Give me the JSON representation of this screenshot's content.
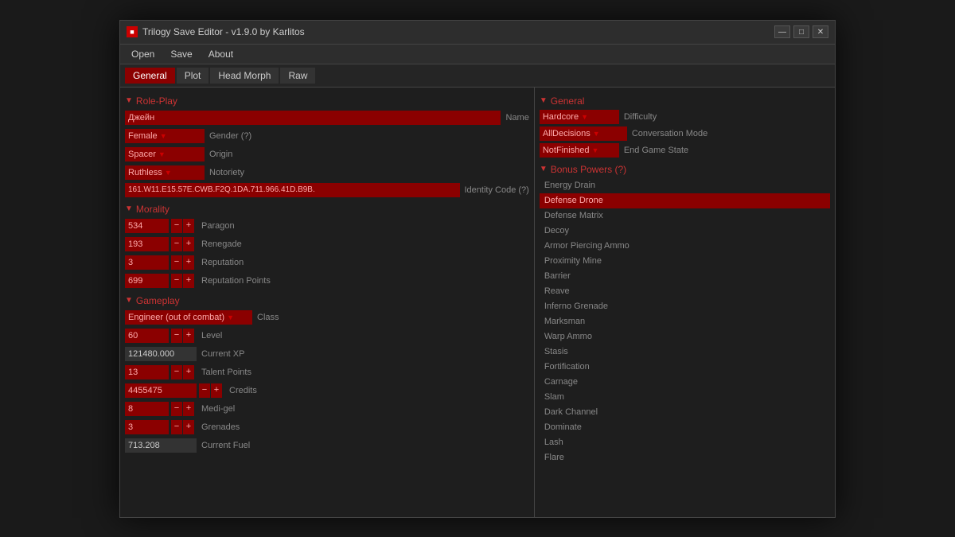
{
  "window": {
    "icon": "■",
    "title": "Trilogy Save Editor - v1.9.0 by Karlitos",
    "controls": {
      "minimize": "—",
      "maximize": "□",
      "close": "✕"
    }
  },
  "menu": {
    "items": [
      "Open",
      "Save",
      "About"
    ]
  },
  "tabs": [
    {
      "label": "General",
      "active": true
    },
    {
      "label": "Plot",
      "active": false
    },
    {
      "label": "Head Morph",
      "active": false
    },
    {
      "label": "Raw",
      "active": false
    }
  ],
  "left": {
    "roleplay": {
      "header": "Role-Play",
      "name_value": "Джейн",
      "name_label": "Name",
      "gender_value": "Female",
      "gender_label": "Gender (?)",
      "origin_value": "Spacer",
      "origin_label": "Origin",
      "notoriety_value": "Ruthless",
      "notoriety_label": "Notoriety",
      "identity_value": "161.W11.E15.57E.CWB.F2Q.1DA.711.966.41D.B9B.",
      "identity_label": "Identity Code (?)"
    },
    "morality": {
      "header": "Morality",
      "paragon_value": "534",
      "paragon_label": "Paragon",
      "renegade_value": "193",
      "renegade_label": "Renegade",
      "reputation_value": "3",
      "reputation_label": "Reputation",
      "rep_points_value": "699",
      "rep_points_label": "Reputation Points"
    },
    "gameplay": {
      "header": "Gameplay",
      "class_value": "Engineer (out of combat)",
      "class_label": "Class",
      "level_value": "60",
      "level_label": "Level",
      "current_xp_value": "121480.000",
      "current_xp_label": "Current XP",
      "talent_value": "13",
      "talent_label": "Talent Points",
      "credits_value": "4455475",
      "credits_label": "Credits",
      "medigel_value": "8",
      "medigel_label": "Medi-gel",
      "grenades_value": "3",
      "grenades_label": "Grenades",
      "fuel_value": "713.208",
      "fuel_label": "Current Fuel"
    }
  },
  "right": {
    "general": {
      "header": "General",
      "difficulty_value": "Hardcore",
      "difficulty_label": "Difficulty",
      "conversation_value": "AllDecisions",
      "conversation_label": "Conversation Mode",
      "endgame_value": "NotFinished",
      "endgame_label": "End Game State"
    },
    "bonus_powers": {
      "header": "Bonus Powers (?)",
      "items": [
        {
          "label": "Energy Drain",
          "selected": false
        },
        {
          "label": "Defense Drone",
          "selected": true
        },
        {
          "label": "Defense Matrix",
          "selected": false
        },
        {
          "label": "Decoy",
          "selected": false
        },
        {
          "label": "Armor Piercing Ammo",
          "selected": false
        },
        {
          "label": "Proximity Mine",
          "selected": false
        },
        {
          "label": "Barrier",
          "selected": false
        },
        {
          "label": "Reave",
          "selected": false
        },
        {
          "label": "Inferno Grenade",
          "selected": false
        },
        {
          "label": "Marksman",
          "selected": false
        },
        {
          "label": "Warp Ammo",
          "selected": false
        },
        {
          "label": "Stasis",
          "selected": false
        },
        {
          "label": "Fortification",
          "selected": false
        },
        {
          "label": "Carnage",
          "selected": false
        },
        {
          "label": "Slam",
          "selected": false
        },
        {
          "label": "Dark Channel",
          "selected": false
        },
        {
          "label": "Dominate",
          "selected": false
        },
        {
          "label": "Lash",
          "selected": false
        },
        {
          "label": "Flare",
          "selected": false
        }
      ]
    }
  }
}
